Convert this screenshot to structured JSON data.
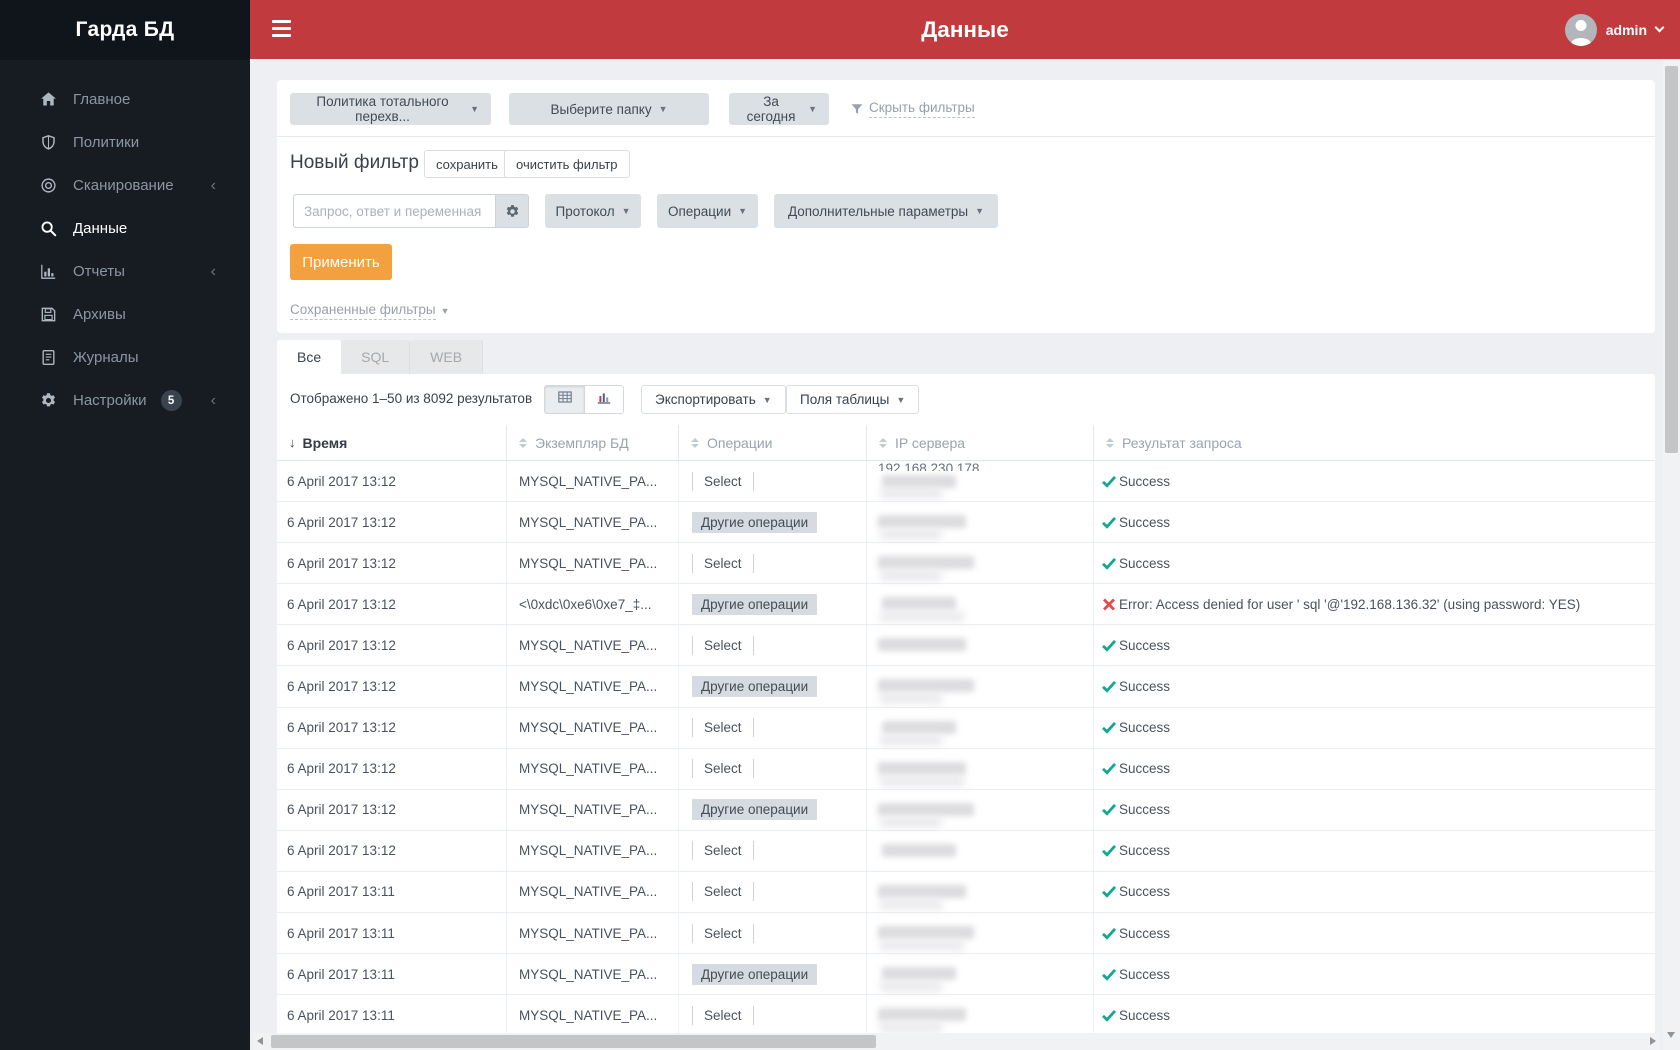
{
  "app": {
    "logo": "Гарда БД",
    "page_title": "Данные",
    "user": "admin"
  },
  "colors": {
    "header-bg": "#c13b3e",
    "sidebar-bg": "#171c22",
    "accent-orange": "#f2a13e",
    "success-green": "#10a893",
    "error-red": "#e4494b"
  },
  "sidebar": {
    "items": [
      {
        "label": "Главное",
        "icon": "home",
        "active": false,
        "chevron": false,
        "badge": ""
      },
      {
        "label": "Политики",
        "icon": "shield",
        "active": false,
        "chevron": false,
        "badge": ""
      },
      {
        "label": "Сканирование",
        "icon": "scan",
        "active": false,
        "chevron": true,
        "badge": ""
      },
      {
        "label": "Данные",
        "icon": "search",
        "active": true,
        "chevron": false,
        "badge": ""
      },
      {
        "label": "Отчеты",
        "icon": "reports",
        "active": false,
        "chevron": true,
        "badge": ""
      },
      {
        "label": "Архивы",
        "icon": "archive",
        "active": false,
        "chevron": false,
        "badge": ""
      },
      {
        "label": "Журналы",
        "icon": "journal",
        "active": false,
        "chevron": false,
        "badge": ""
      },
      {
        "label": "Настройки",
        "icon": "settings",
        "active": false,
        "chevron": true,
        "badge": "5"
      }
    ]
  },
  "filters": {
    "policy_dropdown": "Политика тотального перехв...",
    "folder_dropdown": "Выберите папку",
    "period_dropdown": "За сегодня",
    "hide_filters_link": "Скрыть фильтры",
    "new_filter_title": "Новый фильтр",
    "save_button": "сохранить",
    "clear_button": "очистить фильтр",
    "search_placeholder": "Запрос, ответ и переменная",
    "protocol_dropdown": "Протокол",
    "operations_dropdown": "Операции",
    "additional_dropdown": "Дополнительные параметры",
    "apply_button": "Применить",
    "saved_filters_link": "Сохраненные фильтры"
  },
  "tabs": [
    {
      "label": "Все",
      "active": true
    },
    {
      "label": "SQL",
      "active": false
    },
    {
      "label": "WEB",
      "active": false
    }
  ],
  "toolbar": {
    "results_text": "Отображено 1–50 из 8092 результатов",
    "export_label": "Экспортировать",
    "fields_label": "Поля таблицы"
  },
  "table": {
    "columns": [
      {
        "label": "Время",
        "sorted": true
      },
      {
        "label": "Экземпляр БД",
        "sorted": false
      },
      {
        "label": "Операции",
        "sorted": false
      },
      {
        "label": "IP сервера",
        "sorted": false
      },
      {
        "label": "Результат запроса",
        "sorted": false
      }
    ],
    "rows": [
      {
        "time": "6 April 2017 13:12",
        "instance": "MYSQL_NATIVE_PA...",
        "operation": "Select",
        "op_style": "select",
        "ip_visible": "192.168.230.178",
        "ip_redacted": true,
        "result": "Success",
        "ok": true
      },
      {
        "time": "6 April 2017 13:12",
        "instance": "MYSQL_NATIVE_PA...",
        "operation": "Другие операции",
        "op_style": "other",
        "ip_visible": "",
        "ip_redacted": true,
        "result": "Success",
        "ok": true
      },
      {
        "time": "6 April 2017 13:12",
        "instance": "MYSQL_NATIVE_PA...",
        "operation": "Select",
        "op_style": "select",
        "ip_visible": "",
        "ip_redacted": true,
        "result": "Success",
        "ok": true
      },
      {
        "time": "6 April 2017 13:12",
        "instance": "<\\0xdc\\0xe6\\0xe7_‡...",
        "operation": "Другие операции",
        "op_style": "other",
        "ip_visible": "",
        "ip_redacted": true,
        "result": "Error: Access denied for user ' sql '@'192.168.136.32' (using password: YES)",
        "ok": false
      },
      {
        "time": "6 April 2017 13:12",
        "instance": "MYSQL_NATIVE_PA...",
        "operation": "Select",
        "op_style": "select",
        "ip_visible": "",
        "ip_redacted": true,
        "result": "Success",
        "ok": true
      },
      {
        "time": "6 April 2017 13:12",
        "instance": "MYSQL_NATIVE_PA...",
        "operation": "Другие операции",
        "op_style": "other",
        "ip_visible": "",
        "ip_redacted": true,
        "result": "Success",
        "ok": true
      },
      {
        "time": "6 April 2017 13:12",
        "instance": "MYSQL_NATIVE_PA...",
        "operation": "Select",
        "op_style": "select",
        "ip_visible": "",
        "ip_redacted": true,
        "result": "Success",
        "ok": true
      },
      {
        "time": "6 April 2017 13:12",
        "instance": "MYSQL_NATIVE_PA...",
        "operation": "Select",
        "op_style": "select",
        "ip_visible": "",
        "ip_redacted": true,
        "result": "Success",
        "ok": true
      },
      {
        "time": "6 April 2017 13:12",
        "instance": "MYSQL_NATIVE_PA...",
        "operation": "Другие операции",
        "op_style": "other",
        "ip_visible": "",
        "ip_redacted": true,
        "result": "Success",
        "ok": true
      },
      {
        "time": "6 April 2017 13:12",
        "instance": "MYSQL_NATIVE_PA...",
        "operation": "Select",
        "op_style": "select",
        "ip_visible": "",
        "ip_redacted": true,
        "result": "Success",
        "ok": true
      },
      {
        "time": "6 April 2017 13:11",
        "instance": "MYSQL_NATIVE_PA...",
        "operation": "Select",
        "op_style": "select",
        "ip_visible": "",
        "ip_redacted": true,
        "result": "Success",
        "ok": true
      },
      {
        "time": "6 April 2017 13:11",
        "instance": "MYSQL_NATIVE_PA...",
        "operation": "Select",
        "op_style": "select",
        "ip_visible": "",
        "ip_redacted": true,
        "result": "Success",
        "ok": true
      },
      {
        "time": "6 April 2017 13:11",
        "instance": "MYSQL_NATIVE_PA...",
        "operation": "Другие операции",
        "op_style": "other",
        "ip_visible": "",
        "ip_redacted": true,
        "result": "Success",
        "ok": true
      },
      {
        "time": "6 April 2017 13:11",
        "instance": "MYSQL_NATIVE_PA...",
        "operation": "Select",
        "op_style": "select",
        "ip_visible": "",
        "ip_redacted": true,
        "result": "Success",
        "ok": true
      }
    ]
  }
}
